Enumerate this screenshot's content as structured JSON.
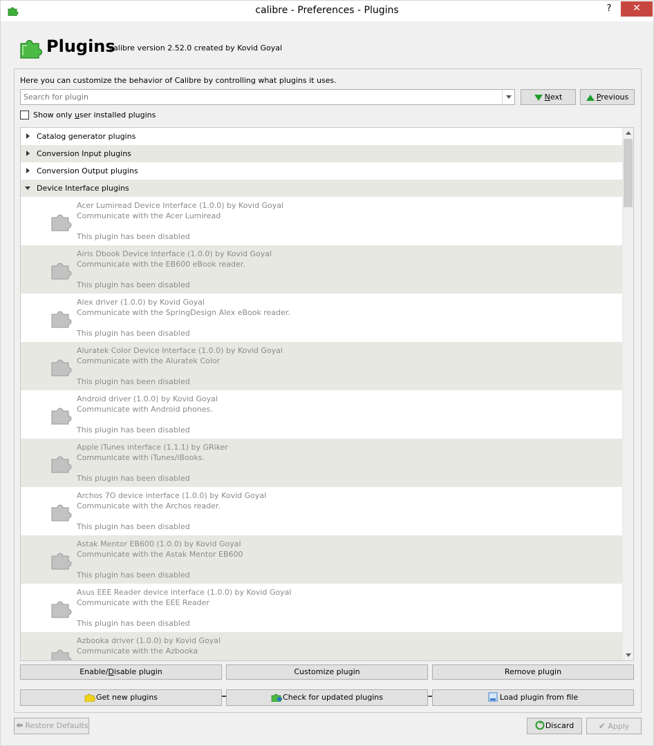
{
  "window": {
    "title": "calibre - Preferences - Plugins",
    "help_label": "?",
    "close_label": "✕"
  },
  "header": {
    "title": "Plugins",
    "subtitle": "calibre version 2.52.0 created by Kovid Goyal"
  },
  "intro_text": "Here you can customize the behavior of Calibre by controlling what plugins it uses.",
  "search": {
    "placeholder": "Search for plugin",
    "value": ""
  },
  "nav_buttons": {
    "next_label_pre": "",
    "next_label_u": "N",
    "next_label_post": "ext",
    "previous_label_u": "P",
    "previous_label_post": "revious"
  },
  "filter": {
    "label_pre": "Show only ",
    "label_u": "u",
    "label_post": "ser installed plugins",
    "checked": false
  },
  "categories": [
    {
      "label": "Catalog generator plugins",
      "expanded": false
    },
    {
      "label": "Conversion Input plugins",
      "expanded": false
    },
    {
      "label": "Conversion Output plugins",
      "expanded": false
    },
    {
      "label": "Device Interface plugins",
      "expanded": true
    }
  ],
  "plugins": [
    {
      "title": "Acer Lumiread Device Interface (1.0.0) by Kovid Goyal",
      "description": "Communicate with the Acer Lumiread",
      "status": "This plugin has been disabled"
    },
    {
      "title": "Airis Dbook Device Interface (1.0.0) by Kovid Goyal",
      "description": "Communicate with the EB600 eBook reader.",
      "status": "This plugin has been disabled"
    },
    {
      "title": "Alex driver (1.0.0) by Kovid Goyal",
      "description": "Communicate with the SpringDesign Alex eBook reader.",
      "status": "This plugin has been disabled"
    },
    {
      "title": "Aluratek Color Device Interface (1.0.0) by Kovid Goyal",
      "description": "Communicate with the Aluratek Color",
      "status": "This plugin has been disabled"
    },
    {
      "title": "Android driver (1.0.0) by Kovid Goyal",
      "description": "Communicate with Android phones.",
      "status": "This plugin has been disabled"
    },
    {
      "title": "Apple iTunes interface (1.1.1) by GRiker",
      "description": "Communicate with iTunes/iBooks.",
      "status": "This plugin has been disabled"
    },
    {
      "title": "Archos 7O device interface (1.0.0) by Kovid Goyal",
      "description": "Communicate with the Archos reader.",
      "status": "This plugin has been disabled"
    },
    {
      "title": "Astak Mentor EB600 (1.0.0) by Kovid Goyal",
      "description": "Communicate with the Astak Mentor EB600",
      "status": "This plugin has been disabled"
    },
    {
      "title": "Asus EEE Reader device interface (1.0.0) by Kovid Goyal",
      "description": "Communicate with the EEE Reader",
      "status": "This plugin has been disabled"
    },
    {
      "title": "Azbooka driver (1.0.0) by Kovid Goyal",
      "description": "Communicate with the Azbooka",
      "status": ""
    }
  ],
  "action_buttons": {
    "enable_disable": "Enable/Disable plugin",
    "enable_disable_u": "D",
    "customize": "Customize plugin",
    "remove": "Remove plugin",
    "get_new": "Get new plugins",
    "check_updates": "Check for updated plugins",
    "load_from_file": "Load plugin from file"
  },
  "footer": {
    "restore_defaults": "Restore Defaults",
    "discard": "Discard",
    "apply": "Apply"
  },
  "colors": {
    "close_button": "#c7463f",
    "accent_green": "#1f9d2c",
    "alt_row": "#e8e8e3"
  }
}
